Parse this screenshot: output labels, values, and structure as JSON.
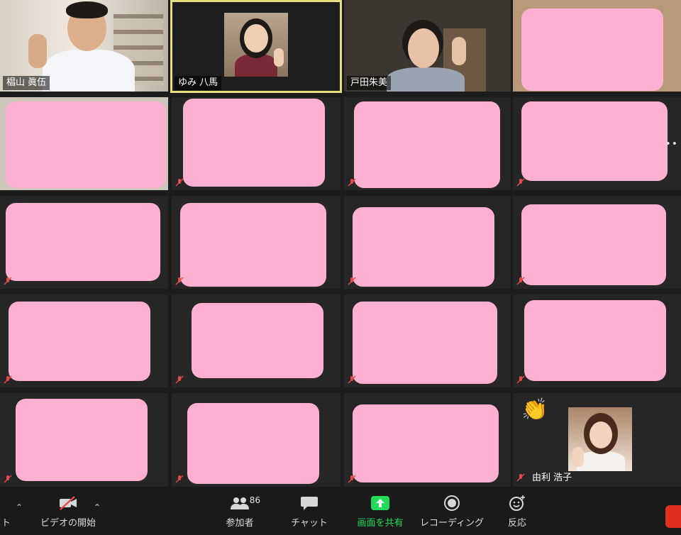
{
  "participants": {
    "named": [
      {
        "name": "椙山 眞伍"
      },
      {
        "name": "ゆみ 八馬"
      },
      {
        "name": "戸田朱美"
      },
      {
        "name": "由利 浩子"
      }
    ]
  },
  "toolbar": {
    "left_cut_label": "ト",
    "video_label": "ビデオの開始",
    "participants_label": "参加者",
    "participants_count": "86",
    "chat_label": "チャット",
    "share_label": "画面を共有",
    "record_label": "レコーディング",
    "reactions_label": "反応"
  },
  "colors": {
    "cover_pink": "#fdb0d1",
    "active_speaker_border": "#e2df7c",
    "share_green": "#23d959",
    "end_red": "#e0301e"
  },
  "icons": [
    "microphone-muted-icon",
    "video-off-icon",
    "participants-icon",
    "chat-icon",
    "share-screen-icon",
    "record-icon",
    "reaction-icon",
    "clap-icon",
    "more-options-icon"
  ]
}
